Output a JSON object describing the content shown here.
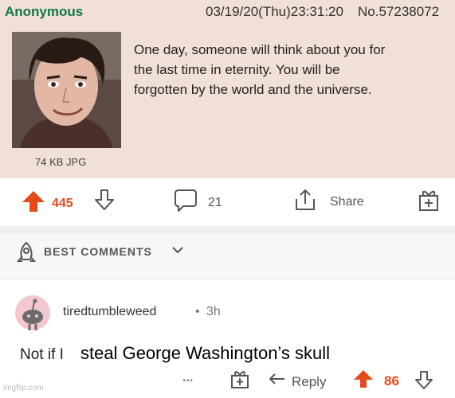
{
  "post": {
    "name": "Anonymous",
    "datetime": "03/19/20(Thu)23:31:20",
    "number": "No.57238072",
    "text_lines": [
      "One day, someone will think about you for",
      "the last time in eternity. You will be",
      "forgotten by the world and the universe."
    ],
    "file_size": "74 KB JPG"
  },
  "actions": {
    "upvotes": "445",
    "comments": "21",
    "share_label": "Share"
  },
  "best_comments": {
    "label": "BEST COMMENTS"
  },
  "comment": {
    "username": "tiredtumbleweed",
    "separator": "•",
    "age": "3h",
    "text_part1": "Not if I",
    "text_part2": "steal George Washington’s skull",
    "more": "...",
    "reply_label": "Reply",
    "votes": "86"
  },
  "watermark": "imgflip.com",
  "colors": {
    "post_bg": "#f0e0d6",
    "name_green": "#117743",
    "upvote_orange": "#e64a19",
    "divider_gray": "#edeff1"
  }
}
